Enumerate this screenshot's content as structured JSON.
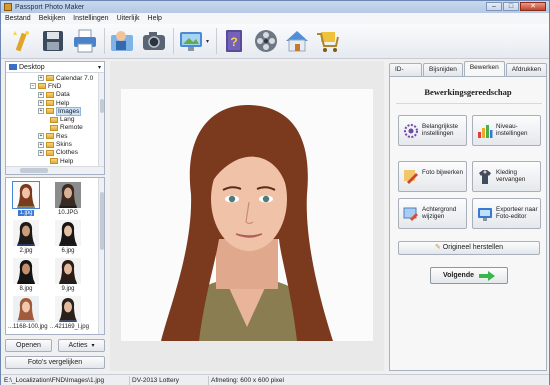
{
  "window": {
    "title": "Passport Photo Maker",
    "controls": {
      "minimize": "–",
      "maximize": "□",
      "close": "✕"
    }
  },
  "menu": [
    "Bestand",
    "Bekijken",
    "Instellingen",
    "Uiterlijk",
    "Help"
  ],
  "toolbar": {
    "buttons": [
      {
        "name": "wizard-button",
        "icon": "magic-wand-icon"
      },
      {
        "name": "save-button",
        "icon": "floppy-icon"
      },
      {
        "name": "print-button",
        "icon": "printer-icon"
      },
      {
        "name": "contacts-button",
        "icon": "user-card-icon"
      },
      {
        "name": "camera-button",
        "icon": "camera-icon"
      },
      {
        "name": "view-button",
        "icon": "monitor-icon"
      },
      {
        "name": "help-button",
        "icon": "help-book-icon"
      },
      {
        "name": "video-button",
        "icon": "film-reel-icon"
      },
      {
        "name": "home-button",
        "icon": "house-icon"
      },
      {
        "name": "shop-button",
        "icon": "cart-icon"
      }
    ],
    "dropdown_arrow": "▾"
  },
  "tree": {
    "root": "Desktop",
    "root_caret": "▾",
    "items": [
      {
        "label": "Calendar 7.0",
        "exp": "+",
        "depth": 4
      },
      {
        "label": "FND",
        "exp": "−",
        "depth": 3
      },
      {
        "label": "Data",
        "exp": "+",
        "depth": 4
      },
      {
        "label": "Help",
        "exp": "+",
        "depth": 4
      },
      {
        "label": "Images",
        "exp": "+",
        "depth": 4,
        "selected": true
      },
      {
        "label": "Lang",
        "exp": "",
        "depth": 4
      },
      {
        "label": "Remote",
        "exp": "",
        "depth": 4
      },
      {
        "label": "Res",
        "exp": "+",
        "depth": 4
      },
      {
        "label": "Skins",
        "exp": "+",
        "depth": 4
      },
      {
        "label": "Clothes",
        "exp": "+",
        "depth": 4
      },
      {
        "label": "Help",
        "exp": "",
        "depth": 4
      }
    ]
  },
  "thumbnails": [
    {
      "caption": "1.jpg",
      "selected": true
    },
    {
      "caption": "10.JPG"
    },
    {
      "caption": "2.jpg"
    },
    {
      "caption": "6.jpg"
    },
    {
      "caption": "8.jpg"
    },
    {
      "caption": "9.jpg"
    },
    {
      "caption": "...1168-100.jpg"
    },
    {
      "caption": "...421169_l.jpg"
    }
  ],
  "left_buttons": {
    "open": "Openen",
    "actions": "Acties",
    "compare": "Foto's vergelijken",
    "actions_caret": "▾"
  },
  "tabs": [
    {
      "label": "ID-kaart"
    },
    {
      "label": "Bijsnijden"
    },
    {
      "label": "Bewerken",
      "active": true
    },
    {
      "label": "Afdrukken"
    }
  ],
  "edit_panel": {
    "title": "Bewerkingsgereedschap",
    "tools": [
      {
        "label": "Belangrijkste instellingen",
        "icon": "gear-sliders-icon"
      },
      {
        "label": "Niveau-instellingen",
        "icon": "bar-levels-icon"
      },
      {
        "label": "Foto bijwerken",
        "icon": "retouch-icon"
      },
      {
        "label": "Kleding vervangen",
        "icon": "clothes-icon"
      },
      {
        "label": "Achtergrond wijzigen",
        "icon": "background-icon"
      },
      {
        "label": "Exporteer naar Foto-editor",
        "icon": "export-icon"
      }
    ],
    "restore": "Origineel herstellen",
    "next": "Volgende"
  },
  "status": {
    "path": "E:\\_Localization\\FND\\Images\\1.jpg",
    "format": "DV-2013 Lottery",
    "size": "Afmeting: 600 x 600 pixel"
  },
  "colors": {
    "accent": "#3a79d1",
    "window_border": "#6b86b0",
    "next_arrow": "#39b54a"
  }
}
